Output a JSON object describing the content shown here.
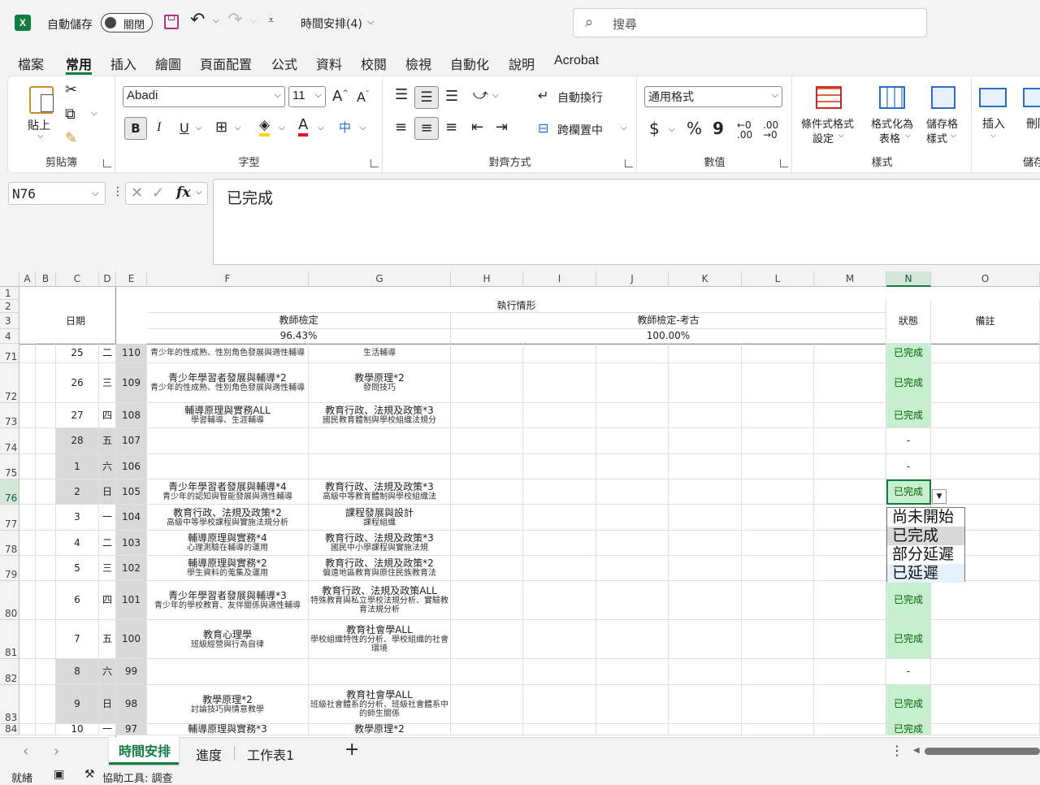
{
  "app": {
    "autosave_label": "自動儲存",
    "autosave_state": "關閉",
    "file_title": "時間安排(4)",
    "search_placeholder": "搜尋"
  },
  "menu": [
    "檔案",
    "常用",
    "插入",
    "繪圖",
    "頁面配置",
    "公式",
    "資料",
    "校閱",
    "檢視",
    "自動化",
    "說明",
    "Acrobat"
  ],
  "menu_active": "常用",
  "ribbon": {
    "clipboard": {
      "title": "剪貼簿",
      "paste": "貼上"
    },
    "font": {
      "title": "字型",
      "font_name": "Abadi",
      "font_size": "11",
      "bold": "B",
      "italic": "I",
      "underline": "U"
    },
    "alignment": {
      "title": "對齊方式",
      "wrap": "自動換行",
      "merge": "跨欄置中"
    },
    "number": {
      "title": "數值",
      "format": "通用格式",
      "currency": "$",
      "percent": "%",
      "comma": "9"
    },
    "styles": {
      "title": "樣式",
      "cond_fmt_1": "條件式格式",
      "cond_fmt_2": "設定",
      "table_fmt_1": "格式化為",
      "table_fmt_2": "表格",
      "cell_style_1": "儲存格",
      "cell_style_2": "樣式"
    },
    "cells": {
      "title": "儲存",
      "insert": "插入",
      "delete": "刪除"
    }
  },
  "formula": {
    "name_box": "N76",
    "content": "已完成",
    "fx": "fx"
  },
  "columns": [
    "A",
    "B",
    "C",
    "D",
    "E",
    "F",
    "G",
    "H",
    "I",
    "J",
    "K",
    "L",
    "M",
    "N",
    "O"
  ],
  "header": {
    "rows": [
      "1",
      "2",
      "3",
      "4"
    ],
    "date": "日期",
    "exec": "執行情形",
    "teacher": "教師檢定",
    "teacher_pct": "96.43%",
    "exam": "教師檢定-考古",
    "exam_pct": "100.00%",
    "status": "狀態",
    "note": "備註"
  },
  "rows": [
    {
      "num": "71",
      "day": "25",
      "wd": "二",
      "cnt": "110",
      "f1": "",
      "f2": "青少年的性成熟、性別角色發展與適性輔導",
      "g1": "",
      "g2": "生活輔導",
      "status": "已完成",
      "gray": false
    },
    {
      "num": "72",
      "day": "26",
      "wd": "三",
      "cnt": "109",
      "f1": "青少年學習者發展與輔導*2",
      "f2": "青少年的性成熟、性別角色發展與適性輔導",
      "g1": "教學原理*2",
      "g2": "發問技巧",
      "status": "已完成",
      "gray": false
    },
    {
      "num": "73",
      "day": "27",
      "wd": "四",
      "cnt": "108",
      "f1": "輔導原理與實務ALL",
      "f2": "學習輔導、生涯輔導",
      "g1": "教育行政、法規及政策*3",
      "g2": "國民教育體制與學校組織法規分",
      "status": "已完成",
      "gray": false
    },
    {
      "num": "74",
      "day": "28",
      "wd": "五",
      "cnt": "107",
      "f1": "",
      "f2": "",
      "g1": "",
      "g2": "",
      "status": "-",
      "gray": true
    },
    {
      "num": "75",
      "day": "1",
      "wd": "六",
      "cnt": "106",
      "f1": "",
      "f2": "",
      "g1": "",
      "g2": "",
      "status": "-",
      "gray": true
    },
    {
      "num": "76",
      "day": "2",
      "wd": "日",
      "cnt": "105",
      "f1": "青少年學習者發展與輔導*4",
      "f2": "青少年的認知與智能發展與適性輔導",
      "g1": "教育行政、法規及政策*3",
      "g2": "高級中等教育體制與學校組織法",
      "status": "已完成",
      "gray": true
    },
    {
      "num": "77",
      "day": "3",
      "wd": "一",
      "cnt": "104",
      "f1": "教育行政、法規及政策*2",
      "f2": "高級中等學校課程與實施法規分析",
      "g1": "課程發展與設計",
      "g2": "課程組織",
      "status": "",
      "gray": false
    },
    {
      "num": "78",
      "day": "4",
      "wd": "二",
      "cnt": "103",
      "f1": "輔導原理與實務*4",
      "f2": "心理測驗在輔導的運用",
      "g1": "教育行政、法規及政策*3",
      "g2": "國民中小學課程與實施法規",
      "status": "",
      "gray": false
    },
    {
      "num": "79",
      "day": "5",
      "wd": "三",
      "cnt": "102",
      "f1": "輔導原理與實務*2",
      "f2": "學生資料的蒐集及運用",
      "g1": "教育行政、法規及政策*2",
      "g2": "偏遠地區教育與原住民族教育法",
      "status": "",
      "gray": false
    },
    {
      "num": "80",
      "day": "6",
      "wd": "四",
      "cnt": "101",
      "f1": "青少年學習者發展與輔導*3",
      "f2": "青少年的學校教育、友伴關係與適性輔導",
      "g1": "教育行政、法規及政策ALL",
      "g2": "特殊教育與私立學校法規分析、實驗教育法規分析",
      "status": "已完成",
      "gray": false
    },
    {
      "num": "81",
      "day": "7",
      "wd": "五",
      "cnt": "100",
      "f1": "教育心理學",
      "f2": "班級經營與行為自律",
      "g1": "教育社會學ALL",
      "g2": "學校組織特性的分析、學校組織的社會環境",
      "status": "已完成",
      "gray": false
    },
    {
      "num": "82",
      "day": "8",
      "wd": "六",
      "cnt": "99",
      "f1": "",
      "f2": "",
      "g1": "",
      "g2": "",
      "status": "-",
      "gray": true
    },
    {
      "num": "83",
      "day": "9",
      "wd": "日",
      "cnt": "98",
      "f1": "教學原理*2",
      "f2": "討論技巧與情意教學",
      "g1": "教育社會學ALL",
      "g2": "班級社會體系的分析、班級社會體系中的師生關係",
      "status": "已完成",
      "gray": true
    },
    {
      "num": "84",
      "day": "10",
      "wd": "一",
      "cnt": "97",
      "f1": "輔導原理與實務*3",
      "f2": "",
      "g1": "教學原理*2",
      "g2": "",
      "status": "已完成",
      "gray": false
    }
  ],
  "dropdown": {
    "options": [
      "尚未開始",
      "已完成",
      "部分延遲",
      "已延遲"
    ],
    "selected": "已完成",
    "hover": "已延遲"
  },
  "tabs": [
    "時間安排",
    "進度",
    "工作表1"
  ],
  "tab_active": "時間安排",
  "statusbar": {
    "ready": "就緒",
    "accessibility": "協助工具: 調查"
  },
  "colors": {
    "excel_green": "#107c41",
    "done_fill": "#c6efce",
    "done_text": "#006100",
    "gray_fill": "#d9d9d9"
  }
}
